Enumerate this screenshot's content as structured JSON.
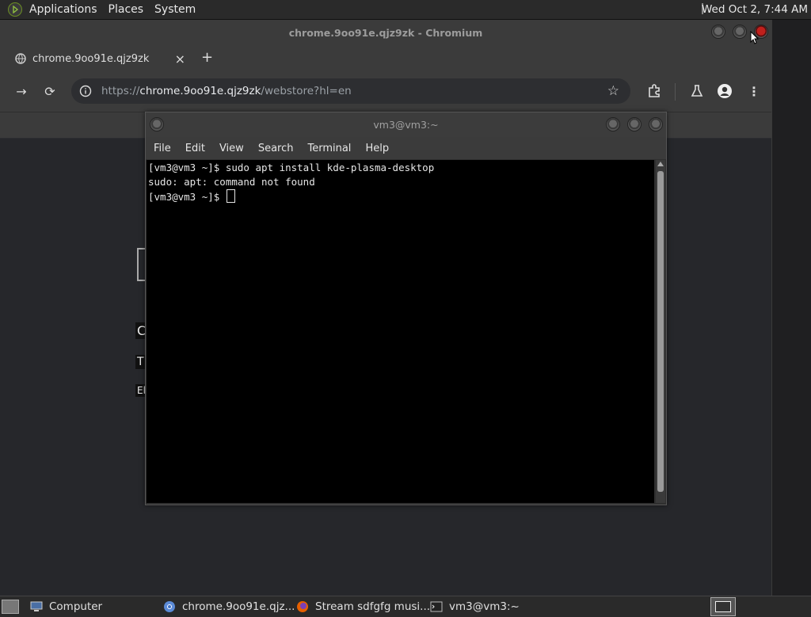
{
  "top_panel": {
    "menu": [
      "Applications",
      "Places",
      "System"
    ],
    "clock": "Wed Oct  2,  7:44 AM"
  },
  "chromium": {
    "window_title": "chrome.9oo91e.qjz9zk - Chromium",
    "tab_title": "chrome.9oo91e.qjz9zk",
    "tab_close": "×",
    "new_tab": "+",
    "url_scheme": "https://",
    "url_host": "chrome.9oo91e.qjz9zk",
    "url_path": "/webstore?hl=en",
    "page_fragments": [
      "C",
      "T",
      "El"
    ]
  },
  "terminal": {
    "window_title": "vm3@vm3:~",
    "menu": [
      "File",
      "Edit",
      "View",
      "Search",
      "Terminal",
      "Help"
    ],
    "lines": [
      "[vm3@vm3 ~]$ sudo apt install kde-plasma-desktop",
      "sudo: apt: command not found",
      "[vm3@vm3 ~]$ "
    ]
  },
  "taskbar": {
    "items": [
      {
        "label": "Computer",
        "icon": "computer-icon"
      },
      {
        "label": "chrome.9oo91e.qjz...",
        "icon": "chromium-icon"
      },
      {
        "label": "Stream sdfgfg musi...",
        "icon": "firefox-icon"
      },
      {
        "label": "vm3@vm3:~",
        "icon": "terminal-icon"
      }
    ]
  },
  "colors": {
    "terminal_bg": "#000000",
    "terminal_fg": "#e6e6e6",
    "close_button": "#c0201c"
  }
}
